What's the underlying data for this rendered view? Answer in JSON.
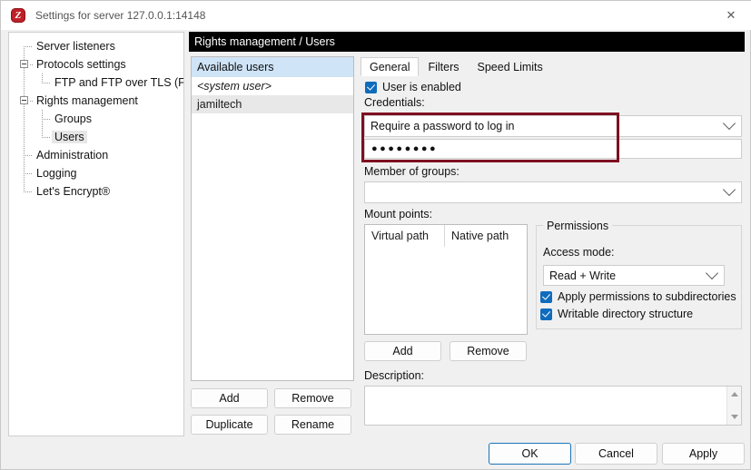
{
  "window": {
    "title": "Settings for server 127.0.0.1:14148",
    "icon": "filezilla-icon",
    "icon_glyph": "Z",
    "close_glyph": "✕"
  },
  "sidebar": {
    "items": [
      {
        "label": "Server listeners",
        "level": 0,
        "expander": false,
        "selected": false
      },
      {
        "label": "Protocols settings",
        "level": 0,
        "expander": true,
        "selected": false
      },
      {
        "label": "FTP and FTP over TLS (FTPS)",
        "level": 1,
        "expander": false,
        "selected": false
      },
      {
        "label": "Rights management",
        "level": 0,
        "expander": true,
        "selected": false
      },
      {
        "label": "Groups",
        "level": 1,
        "expander": false,
        "selected": false
      },
      {
        "label": "Users",
        "level": 1,
        "expander": false,
        "selected": true
      },
      {
        "label": "Administration",
        "level": 0,
        "expander": false,
        "selected": false
      },
      {
        "label": "Logging",
        "level": 0,
        "expander": false,
        "selected": false
      },
      {
        "label": "Let's Encrypt®",
        "level": 0,
        "expander": false,
        "selected": false
      }
    ]
  },
  "pane": {
    "header": "Rights management / Users"
  },
  "users": {
    "header": "Available users",
    "rows": [
      {
        "label": "<system user>",
        "italic": true,
        "selected": false
      },
      {
        "label": "jamiltech",
        "italic": false,
        "selected": true
      }
    ],
    "buttons": {
      "add": "Add",
      "remove": "Remove",
      "duplicate": "Duplicate",
      "rename": "Rename"
    }
  },
  "tabs": [
    {
      "label": "General",
      "active": true
    },
    {
      "label": "Filters",
      "active": false
    },
    {
      "label": "Speed Limits",
      "active": false
    }
  ],
  "general": {
    "user_enabled_label": "User is enabled",
    "user_enabled_checked": true,
    "credentials_label": "Credentials:",
    "credentials_mode": "Require a password to log in",
    "password_value": "●●●●●●●●",
    "member_of_groups_label": "Member of groups:",
    "member_of_groups_value": "",
    "mount_points_label": "Mount points:",
    "mount_points_columns": [
      "Virtual path",
      "Native path"
    ],
    "mount_points_rows": [],
    "mount_add": "Add",
    "mount_remove": "Remove",
    "description_label": "Description:",
    "description_value": ""
  },
  "permissions": {
    "title": "Permissions",
    "access_mode_label": "Access mode:",
    "access_mode_value": "Read + Write",
    "checkboxes": [
      {
        "label": "Apply permissions to subdirectories",
        "checked": true
      },
      {
        "label": "Writable directory structure",
        "checked": true
      }
    ]
  },
  "footer": {
    "ok": "OK",
    "cancel": "Cancel",
    "apply": "Apply"
  },
  "colors": {
    "highlight_box": "#7e0f22",
    "header_bar": "#000000",
    "checkbox_blue": "#0f6cbd",
    "list_header_blue": "#cfe4f7",
    "focus_border": "#1a74b8"
  }
}
